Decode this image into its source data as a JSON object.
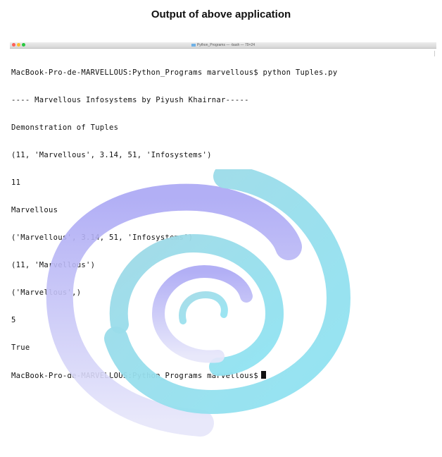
{
  "heading": "Output of above application",
  "terminal": {
    "window_title": "Python_Programs — -bash — 79×24",
    "lines": [
      "MacBook-Pro-de-MARVELLOUS:Python_Programs marvellous$ python Tuples.py",
      "---- Marvellous Infosystems by Piyush Khairnar-----",
      "Demonstration of Tuples",
      "(11, 'Marvellous', 3.14, 51, 'Infosystems')",
      "11",
      "Marvellous",
      "('Marvellous', 3.14, 51, 'Infosystems')",
      "(11, 'Marvellous')",
      "('Marvellous',)",
      "5",
      "True"
    ],
    "prompt": "MacBook-Pro-de-MARVELLOUS:Python_Programs marvellous$"
  },
  "colors": {
    "swirl_purple": "#b3b1f5",
    "swirl_cyan": "#8fe0ee"
  },
  "icons": [
    "folder-icon",
    "close-button",
    "minimize-button",
    "zoom-button",
    "cursor",
    "swirl-watermark"
  ]
}
